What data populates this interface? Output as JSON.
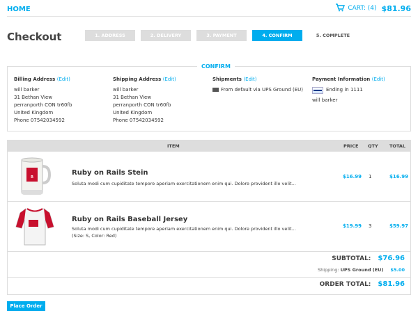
{
  "header": {
    "home_label": "HOME",
    "cart_label": "CART: (4)",
    "cart_total": "$81.96"
  },
  "page_title": "Checkout",
  "steps": [
    {
      "label": "1. ADDRESS",
      "state": "done"
    },
    {
      "label": "2. DELIVERY",
      "state": "done"
    },
    {
      "label": "3. PAYMENT",
      "state": "done"
    },
    {
      "label": "4. CONFIRM",
      "state": "active"
    },
    {
      "label": "5. COMPLETE",
      "state": "pending"
    }
  ],
  "confirm": {
    "legend": "CONFIRM",
    "billing": {
      "title": "Billing Address",
      "edit": "(Edit)",
      "lines": [
        "will barker",
        "31 Bethan View",
        "perranporth CON tr60fb",
        "United Kingdom",
        "Phone 07542034592"
      ]
    },
    "shipping": {
      "title": "Shipping Address",
      "edit": "(Edit)",
      "lines": [
        "will barker",
        "31 Bethan View",
        "perranporth CON tr60fb",
        "United Kingdom",
        "Phone 07542034592"
      ]
    },
    "shipments": {
      "title": "Shipments",
      "edit": "(Edit)",
      "line": "From default via UPS Ground (EU)"
    },
    "payment": {
      "title": "Payment Information",
      "edit": "(Edit)",
      "card_line": "Ending in 1111",
      "name": "will barker"
    }
  },
  "table": {
    "headers": {
      "item": "ITEM",
      "price": "PRICE",
      "qty": "QTY",
      "total": "TOTAL"
    },
    "items": [
      {
        "name": "Ruby on Rails Stein",
        "description": "Soluta modi cum cupiditate tempore aperiam exercitationem enim qui. Dolore provident illo velit...",
        "price": "$16.99",
        "qty": "1",
        "total": "$16.99"
      },
      {
        "name": "Ruby on Rails Baseball Jersey",
        "description": "Soluta modi cum cupiditate tempore aperiam exercitationem enim qui. Dolore provident illo velit... (Size: S, Color: Red)",
        "price": "$19.99",
        "qty": "3",
        "total": "$59.97"
      }
    ]
  },
  "summary": {
    "subtotal_label": "SUBTOTAL:",
    "subtotal_value": "$76.96",
    "shipping_prefix": "Shipping:",
    "shipping_method": "UPS Ground (EU)",
    "shipping_value": "$5.00",
    "order_total_label": "ORDER TOTAL:",
    "order_total_value": "$81.96"
  },
  "place_order_label": "Place Order",
  "colors": {
    "accent": "#00adee",
    "step_inactive": "#dddddd"
  }
}
